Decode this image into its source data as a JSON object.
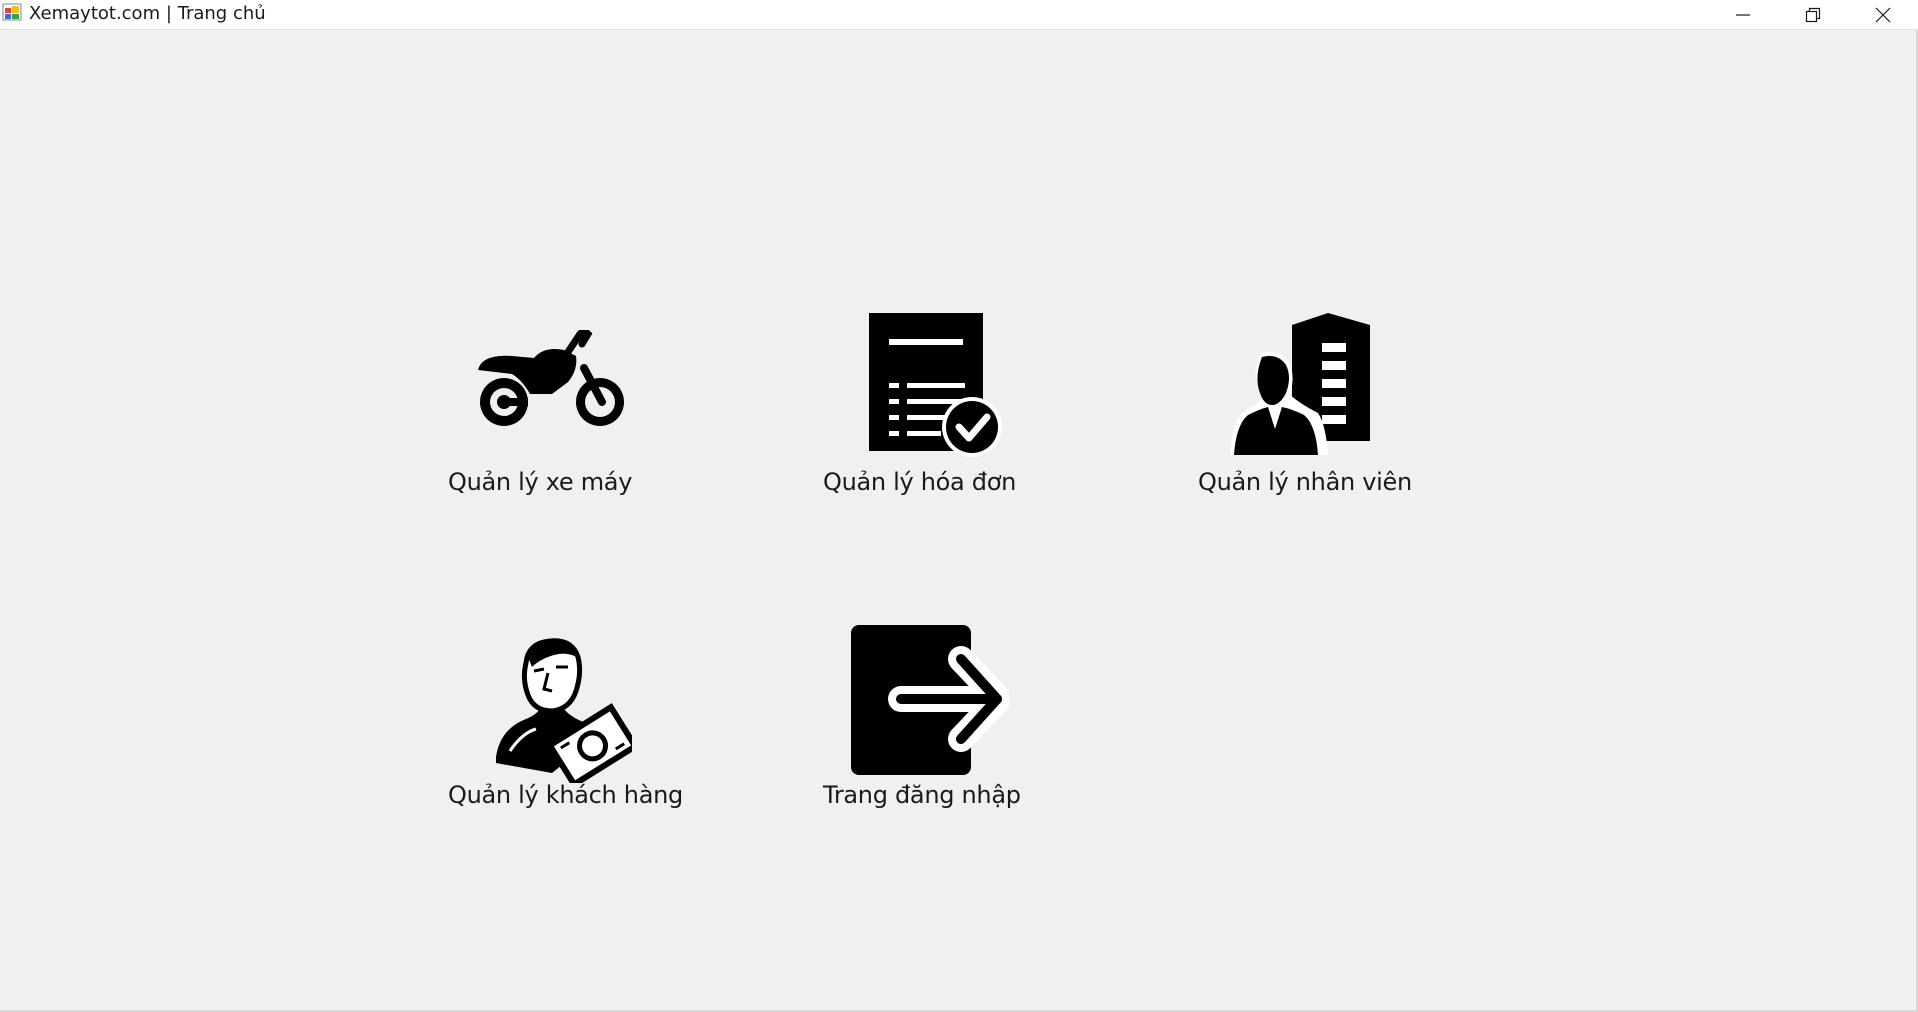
{
  "window": {
    "title": "Xemaytot.com | Trang chủ",
    "controls": {
      "minimize": "minimize-icon",
      "restore": "restore-icon",
      "close": "close-icon"
    }
  },
  "menu": {
    "tiles": [
      {
        "label": "Quản lý xe máy",
        "icon": "motorcycle-icon"
      },
      {
        "label": "Quản lý hóa đơn",
        "icon": "invoice-check-icon"
      },
      {
        "label": "Quản lý nhân viên",
        "icon": "employee-building-icon"
      },
      {
        "label": "Quản lý khách hàng",
        "icon": "customer-money-icon"
      },
      {
        "label": "Trang đăng nhập",
        "icon": "logout-arrow-icon"
      }
    ]
  },
  "colors": {
    "titlebar": "#ffffff",
    "background": "#f0f0f0",
    "icon": "#000000",
    "text": "#1a1a1a"
  }
}
